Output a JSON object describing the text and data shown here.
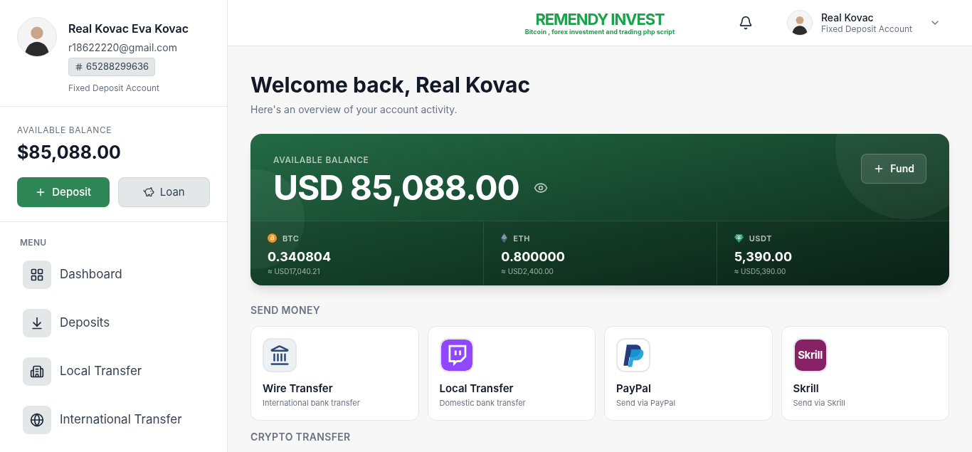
{
  "profile": {
    "name": "Real Kovac Eva Kovac",
    "email": "r18622220@gmail.com",
    "account_number": "65288299636",
    "account_type": "Fixed Deposit Account"
  },
  "sidebar_balance": {
    "label": "AVAILABLE BALANCE",
    "amount": "$85,088.00",
    "buttons": [
      {
        "kind": "primary",
        "label": "Deposit"
      },
      {
        "kind": "secondary",
        "label": "Loan"
      }
    ]
  },
  "menu": {
    "title": "MENU",
    "items": [
      {
        "kind": "dashboard",
        "label": "Dashboard"
      },
      {
        "kind": "deposits",
        "label": "Deposits"
      },
      {
        "kind": "local",
        "label": "Local Transfer"
      },
      {
        "kind": "international",
        "label": "International Transfer"
      }
    ]
  },
  "header": {
    "logo": {
      "title": "REMENDY INVEST",
      "tagline": "Bitcoin , forex investment and trading php script"
    },
    "user": {
      "name": "Real Kovac",
      "account_type": "Fixed Deposit Account"
    }
  },
  "welcome": {
    "title": "Welcome back, Real Kovac",
    "subtitle": "Here's an overview of your account activity."
  },
  "balance_card": {
    "label": "AVAILABLE BALANCE",
    "amount": "USD 85,088.00",
    "fund_button": "Fund",
    "assets": [
      {
        "kind": "btc",
        "symbol": "BTC",
        "amount": "0.340804",
        "usd": "≈ USD17,040.21"
      },
      {
        "kind": "eth",
        "symbol": "ETH",
        "amount": "0.800000",
        "usd": "≈ USD2,400.00"
      },
      {
        "kind": "usdt",
        "symbol": "USDT",
        "amount": "5,390.00",
        "usd": "≈ USD5,390.00"
      }
    ]
  },
  "send_money": {
    "title": "SEND MONEY",
    "options": [
      {
        "kind": "wire",
        "title": "Wire Transfer",
        "subtitle": "International bank transfer"
      },
      {
        "kind": "local",
        "title": "Local Transfer",
        "subtitle": "Domestic bank transfer"
      },
      {
        "kind": "paypal",
        "title": "PayPal",
        "subtitle": "Send via PayPal"
      },
      {
        "kind": "skrill",
        "title": "Skrill",
        "subtitle": "Send via Skrill",
        "logo_text": "Skrill"
      }
    ]
  },
  "next_section": {
    "title": "CRYPTO TRANSFER"
  }
}
